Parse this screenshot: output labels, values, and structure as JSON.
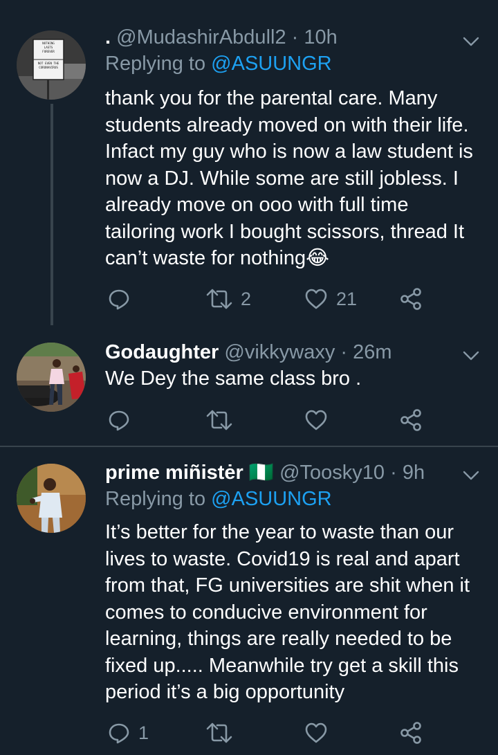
{
  "tweets": [
    {
      "avatar_lines": [
        "NOTHING",
        "LASTS",
        "FOREVER",
        "NOT EVEN THE",
        "CORONAVIRUS"
      ],
      "name": ".",
      "handle": "@MudashirAbdull2",
      "sep": "·",
      "time": "10h",
      "replying_label": "Replying to",
      "replying_to": "@ASUUNGR",
      "text": "thank you for the parental care. Many students already moved on with their life. Infact my guy who is now a law student is now a DJ. While some are still jobless. I already move on ooo with full time tailoring work I bought scissors, thread  It can’t  waste for nothing😂",
      "reply_count": "",
      "retweet_count": "2",
      "like_count": "21"
    },
    {
      "name": "Godaughter",
      "handle": "@vikkywaxy",
      "sep": "·",
      "time": "26m",
      "text": "We Dey the same class bro .",
      "reply_count": "",
      "retweet_count": "",
      "like_count": ""
    },
    {
      "name": "prime miñistėr 🇳🇬",
      "handle": "@Toosky10",
      "sep": "·",
      "time": "9h",
      "replying_label": "Replying to",
      "replying_to": "@ASUUNGR",
      "text": "It’s better for the year to waste than our lives to waste. Covid19 is real and apart from that, FG universities are shit when it comes to conducive environment for learning, things are really needed to be fixed up..... Meanwhile try get a skill this period it’s a big opportunity",
      "reply_count": "1",
      "retweet_count": "",
      "like_count": ""
    }
  ],
  "colors": {
    "background": "#15202b",
    "secondary_text": "#8899a6",
    "accent": "#1da1f2",
    "divider": "#38444d"
  },
  "icons": [
    "reply-icon",
    "retweet-icon",
    "like-icon",
    "share-icon",
    "chevron-down-icon"
  ]
}
